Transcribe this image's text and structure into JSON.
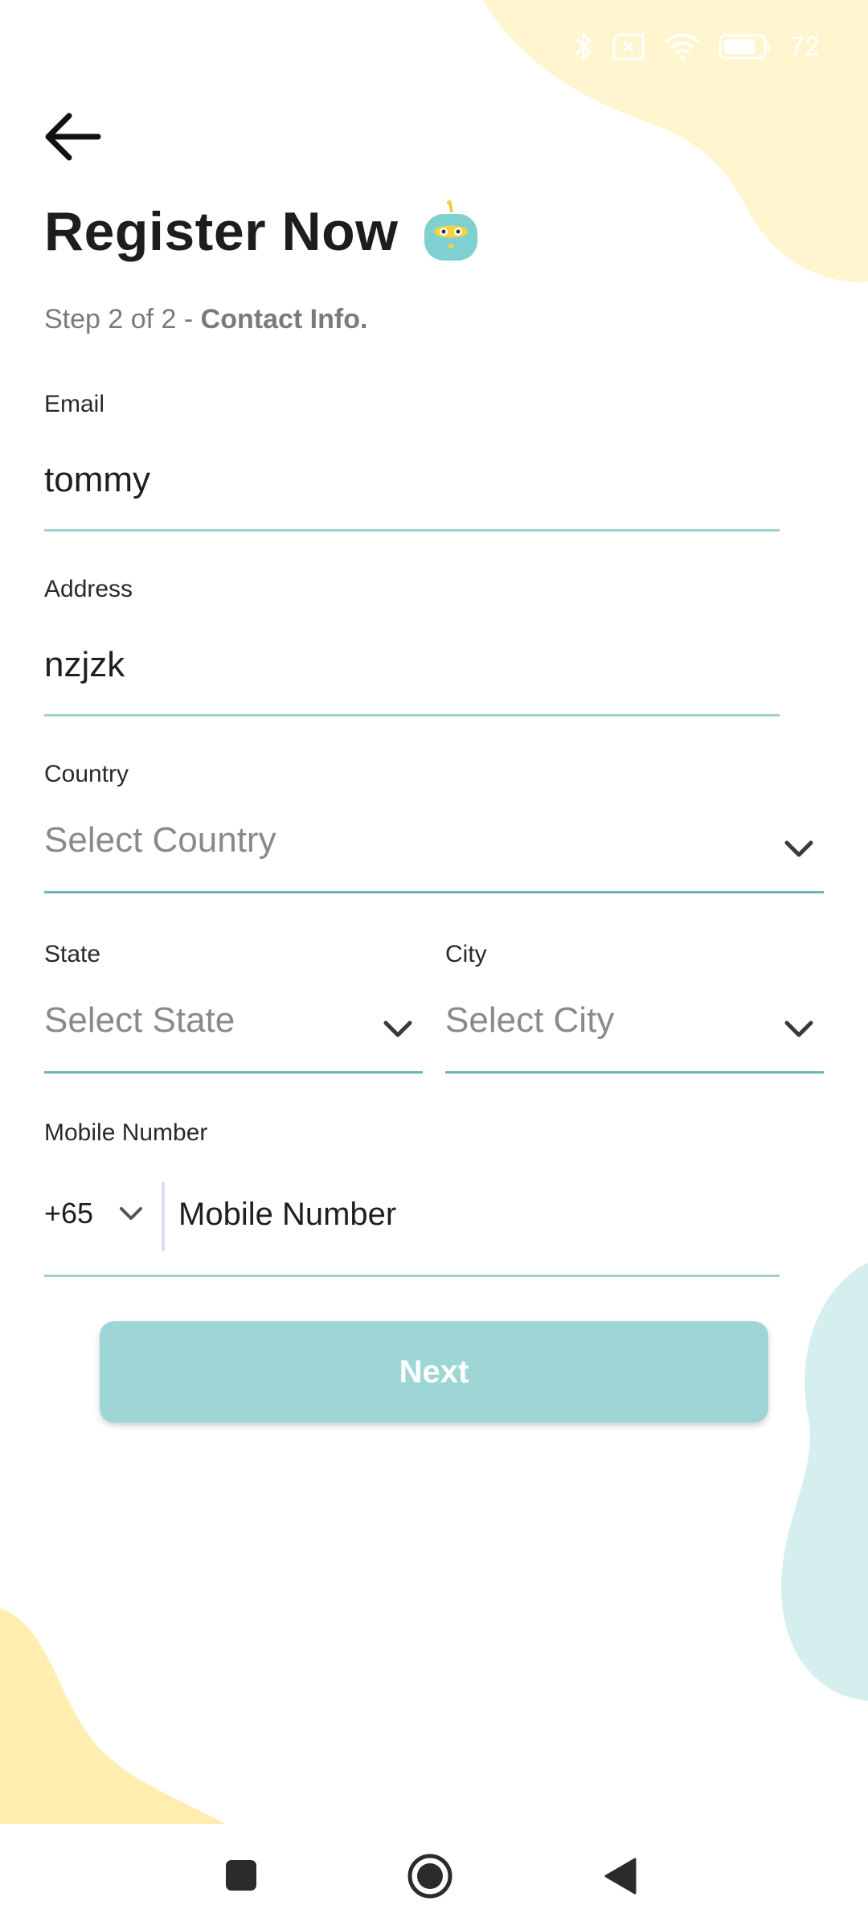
{
  "status_bar": {
    "battery_level": "72"
  },
  "header": {
    "title": "Register Now",
    "step_prefix": "Step 2 of 2 - ",
    "step_section": "Contact Info."
  },
  "form": {
    "email": {
      "label": "Email",
      "value": "tommy"
    },
    "address": {
      "label": "Address",
      "value": "nzjzk"
    },
    "country": {
      "label": "Country",
      "placeholder": "Select Country"
    },
    "state": {
      "label": "State",
      "placeholder": "Select State"
    },
    "city": {
      "label": "City",
      "placeholder": "Select City"
    },
    "mobile": {
      "label": "Mobile Number",
      "country_code": "+65",
      "placeholder": "Mobile Number"
    }
  },
  "actions": {
    "next_label": "Next"
  },
  "colors": {
    "accent": "#9dd6d5",
    "underline": "#9fd3d3",
    "blob_yellow": "#fff5cf",
    "blob_teal": "#d5eeee"
  }
}
